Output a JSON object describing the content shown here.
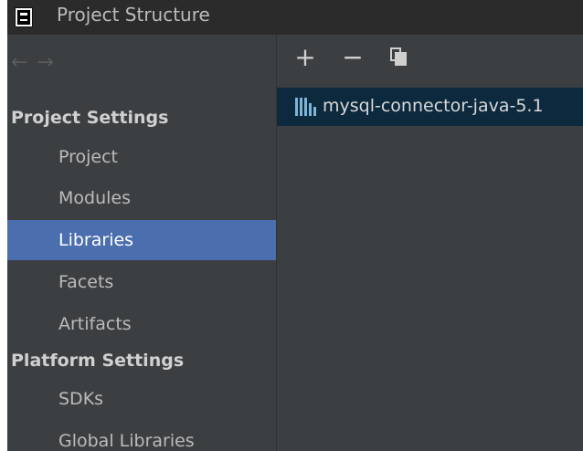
{
  "window": {
    "title": "Project Structure"
  },
  "navigation": {
    "back_icon": "←",
    "forward_icon": "→"
  },
  "sidebar": {
    "project_settings_heading": "Project Settings",
    "project_items": [
      {
        "label": "Project",
        "selected": false
      },
      {
        "label": "Modules",
        "selected": false
      },
      {
        "label": "Libraries",
        "selected": true
      },
      {
        "label": "Facets",
        "selected": false
      },
      {
        "label": "Artifacts",
        "selected": false
      }
    ],
    "platform_settings_heading": "Platform Settings",
    "platform_items": [
      {
        "label": "SDKs",
        "selected": false
      },
      {
        "label": "Global Libraries",
        "selected": false
      }
    ]
  },
  "toolbar": {
    "add_icon": "+",
    "remove_icon": "−",
    "copy_icon": "copy-icon"
  },
  "libraries": {
    "items": [
      {
        "name": "mysql-connector-java-5.1",
        "selected": true
      }
    ]
  },
  "colors": {
    "sidebar_bg": "#3c3f41",
    "selection": "#4b6eaf",
    "list_selection": "#0d293e",
    "titlebar_bg": "#2b2b2b"
  }
}
